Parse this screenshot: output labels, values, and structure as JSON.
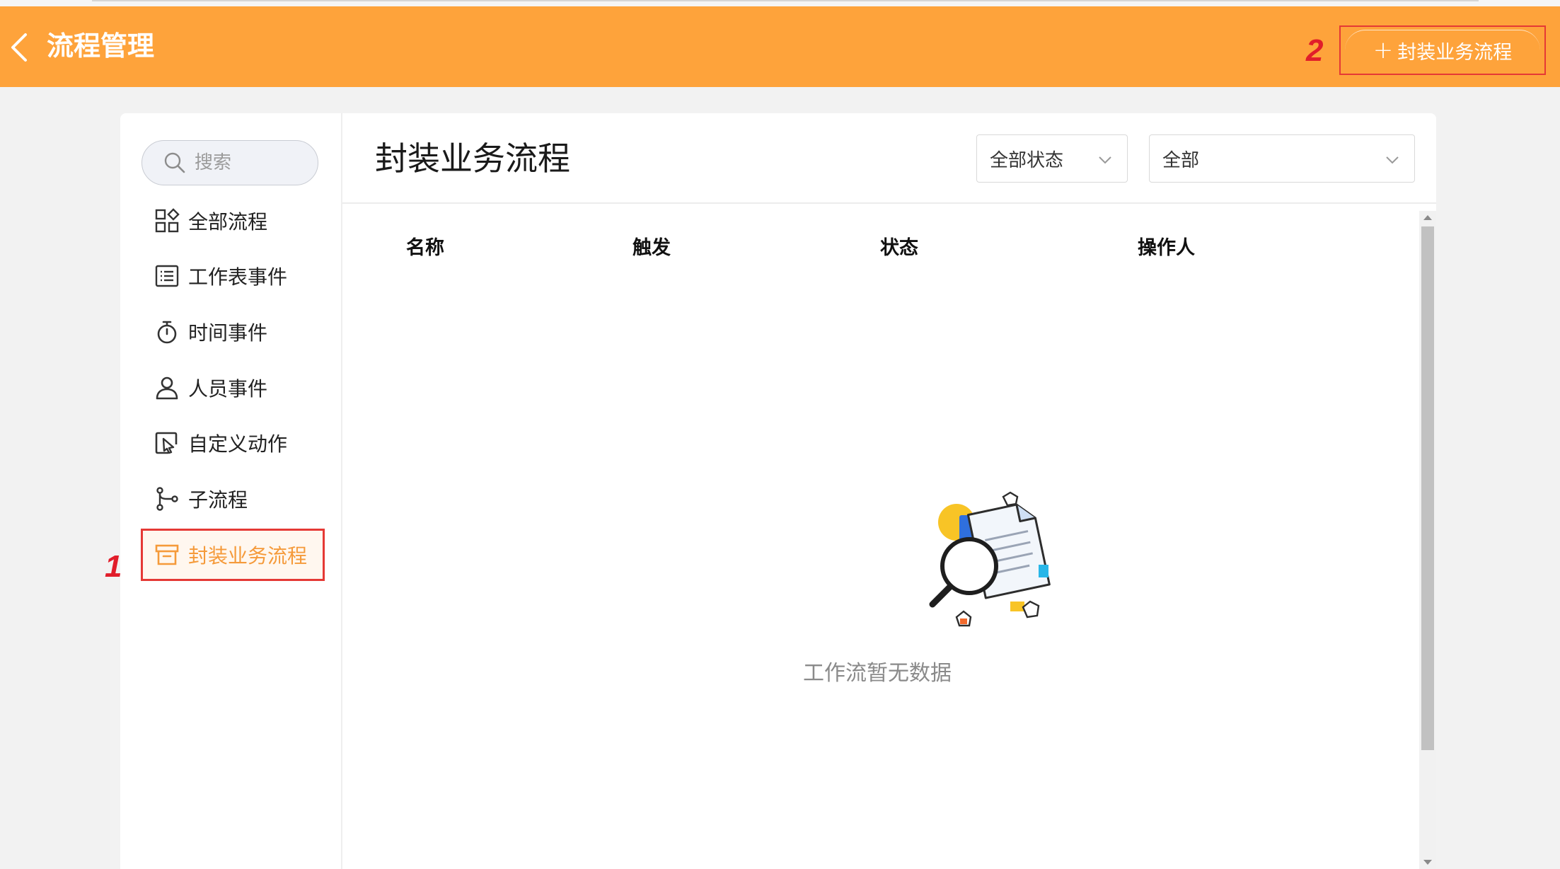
{
  "header": {
    "title": "流程管理",
    "add_button_label": "封装业务流程",
    "background_color": "#fea33b"
  },
  "annotations": [
    "1",
    "2"
  ],
  "sidebar": {
    "search_placeholder": "搜索",
    "items": [
      {
        "label": "全部流程",
        "icon": "grid-icon"
      },
      {
        "label": "工作表事件",
        "icon": "worksheet-list-icon"
      },
      {
        "label": "时间事件",
        "icon": "stopwatch-icon"
      },
      {
        "label": "人员事件",
        "icon": "user-icon"
      },
      {
        "label": "自定义动作",
        "icon": "cursor-click-icon"
      },
      {
        "label": "子流程",
        "icon": "branch-icon"
      },
      {
        "label": "封装业务流程",
        "icon": "archive-box-icon",
        "active": true
      }
    ],
    "active_color": "#f59a3a"
  },
  "main": {
    "title": "封装业务流程",
    "status_filter": "全部状态",
    "type_filter": "全部",
    "columns": [
      "名称",
      "触发",
      "状态",
      "操作人"
    ],
    "empty_text": "工作流暂无数据"
  }
}
